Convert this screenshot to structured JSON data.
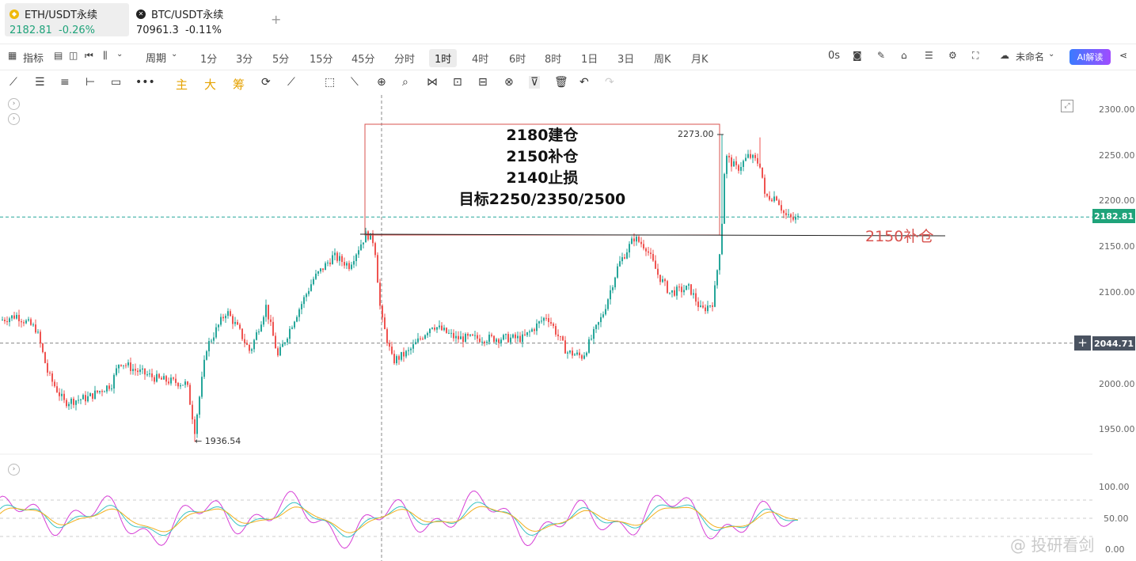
{
  "tabs": [
    {
      "symbol": "ETH/USDT永续",
      "price": "2182.81",
      "change": "-0.26%"
    },
    {
      "symbol": "BTC/USDT永续",
      "price": "70961.3",
      "change": "-0.11%"
    }
  ],
  "toolbar": {
    "indicators": "指标",
    "period": "周期",
    "timeframes": [
      "1分",
      "3分",
      "5分",
      "15分",
      "45分",
      "分时",
      "1时",
      "4时",
      "6时",
      "8时",
      "1日",
      "3日",
      "周K",
      "月K"
    ],
    "active_timeframe": "1时",
    "countdown": "0s",
    "layout_name": "未命名",
    "ai_label": "AI解读"
  },
  "drawing_tools": {
    "main": "主",
    "big": "大",
    "chip": "筹"
  },
  "chart": {
    "y_labels": [
      "2300.00",
      "2250.00",
      "2200.00",
      "2150.00",
      "2100.00",
      "2050.00",
      "2000.00",
      "1950.00"
    ],
    "current_price": "2182.81",
    "crosshair_price": "2044.71",
    "high_label": "2273.00",
    "low_label": "← 1936.54",
    "plan_lines": [
      "2180建仓",
      "2150补仓",
      "2140止损",
      "目标2250/2350/2500"
    ],
    "line_label": "2150补仓",
    "osc_labels": [
      "100.00",
      "50.00",
      "0.00"
    ]
  },
  "colors": {
    "up": "#26a69a",
    "down": "#ef5350",
    "box": "#d9534f"
  },
  "watermark": "@ 投研看剑"
}
